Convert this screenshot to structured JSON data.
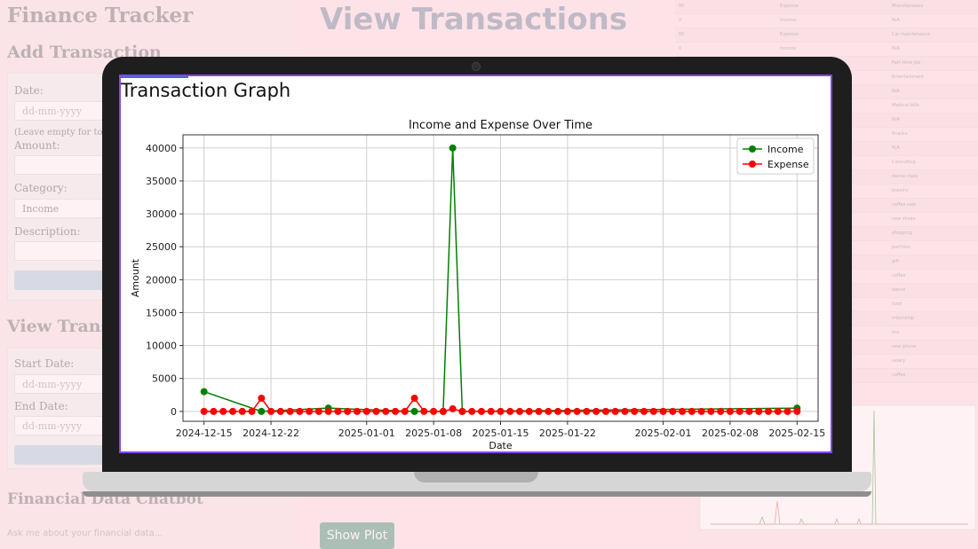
{
  "app": {
    "title": "Finance Tracker"
  },
  "add_transaction": {
    "heading": "Add Transaction",
    "date_label": "Date:",
    "date_placeholder": "dd-mm-yyyy",
    "date_hint": "(Leave empty for today)",
    "amount_label": "Amount:",
    "category_label": "Category:",
    "category_value": "Income",
    "description_label": "Description:"
  },
  "view_transactions_form": {
    "heading": "View Transac",
    "start_label": "Start Date:",
    "start_placeholder": "dd-mm-yyyy",
    "end_label": "End Date:",
    "end_placeholder": "dd-mm-yyyy"
  },
  "chatbot": {
    "heading": "Financial Data Chatbot",
    "placeholder": "Ask me about your financial data..."
  },
  "main": {
    "title": "View Transactions",
    "show_plot_label": "Show Plot"
  },
  "table_rows": [
    [
      "50",
      "Expense",
      "Miscellaneous"
    ],
    [
      "0",
      "Income",
      "N/A"
    ],
    [
      "60",
      "Expense",
      "Car maintenance"
    ],
    [
      "0",
      "Income",
      "N/A"
    ],
    [
      "",
      "",
      "Part-time job"
    ],
    [
      "",
      "",
      "Entertainment"
    ],
    [
      "",
      "",
      "N/A"
    ],
    [
      "",
      "",
      "Medical bills"
    ],
    [
      "",
      "",
      "N/A"
    ],
    [
      "",
      "",
      "Snacks"
    ],
    [
      "",
      "",
      "N/A"
    ],
    [
      "",
      "",
      "Consulting"
    ],
    [
      "",
      "",
      "dance class"
    ],
    [
      "",
      "",
      "jewelry"
    ],
    [
      "",
      "",
      "coffee sale"
    ],
    [
      "",
      "",
      "new shoes"
    ],
    [
      "",
      "",
      "shopping"
    ],
    [
      "",
      "",
      "partition"
    ],
    [
      "",
      "",
      "gift"
    ],
    [
      "",
      "",
      "coffee"
    ],
    [
      "",
      "",
      "dance"
    ],
    [
      "",
      "",
      "food"
    ],
    [
      "",
      "",
      "internship"
    ],
    [
      "",
      "",
      "tea"
    ],
    [
      "",
      "",
      "new phone"
    ],
    [
      "",
      "",
      "salary"
    ],
    [
      "",
      "",
      "coffee"
    ]
  ],
  "modal": {
    "title": "Transaction Graph"
  },
  "colors": {
    "income": "#008000",
    "expense": "#ff0000",
    "border": "#8346f0"
  },
  "chart_data": {
    "type": "line",
    "title": "Income and Expense Over Time",
    "xlabel": "Date",
    "ylabel": "Amount",
    "ylim": [
      -1500,
      42000
    ],
    "yticks": [
      0,
      5000,
      10000,
      15000,
      20000,
      25000,
      30000,
      35000,
      40000
    ],
    "xticks": [
      "2024-12-15",
      "2024-12-22",
      "2025-01-01",
      "2025-01-08",
      "2025-01-15",
      "2025-01-22",
      "2025-02-01",
      "2025-02-08",
      "2025-02-15"
    ],
    "grid": true,
    "legend_position": "top-right",
    "series": [
      {
        "name": "Income",
        "color": "#008000",
        "points": [
          {
            "x": "2024-12-15",
            "y": 3000
          },
          {
            "x": "2024-12-21",
            "y": 0
          },
          {
            "x": "2024-12-28",
            "y": 500
          },
          {
            "x": "2025-01-06",
            "y": 0
          },
          {
            "x": "2025-01-09",
            "y": 0
          },
          {
            "x": "2025-01-10",
            "y": 40000
          },
          {
            "x": "2025-01-11",
            "y": 0
          },
          {
            "x": "2025-02-15",
            "y": 500
          }
        ]
      },
      {
        "name": "Expense",
        "color": "#ff0000",
        "range": {
          "start": "2024-12-15",
          "end": "2025-02-15",
          "default": 0
        },
        "overrides": [
          {
            "x": "2024-12-21",
            "y": 2000
          },
          {
            "x": "2025-01-06",
            "y": 2000
          },
          {
            "x": "2025-01-10",
            "y": 400
          }
        ]
      }
    ]
  }
}
